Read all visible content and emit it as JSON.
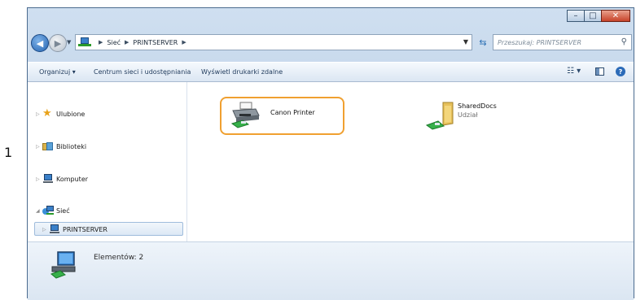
{
  "margin_label": "1",
  "window": {
    "caption_buttons": {
      "minimize": "–",
      "maximize": "□",
      "close": "✕"
    }
  },
  "address_bar": {
    "crumbs": [
      "Sieć",
      "PRINTSERVER"
    ],
    "search_placeholder": "Przeszukaj: PRINTSERVER"
  },
  "command_bar": {
    "organize": "Organizuj ▾",
    "network_center": "Centrum sieci i udostępniania",
    "remote_printers": "Wyświetl drukarki zdalne"
  },
  "nav_pane": {
    "favorites": "Ulubione",
    "libraries": "Biblioteki",
    "computer": "Komputer",
    "network": "Sieć",
    "printserver": "PRINTSERVER"
  },
  "content": {
    "items": [
      {
        "name": "Canon Printer",
        "icon": "printer-icon"
      },
      {
        "name": "SharedDocs",
        "subtitle": "Udział",
        "icon": "shared-folder-icon"
      }
    ]
  },
  "status_bar": {
    "text": "Elementów: 2"
  },
  "colors": {
    "highlight": "#f0a030",
    "window_chrome": "#bcd0e6",
    "accent_blue": "#2c6bb8"
  }
}
